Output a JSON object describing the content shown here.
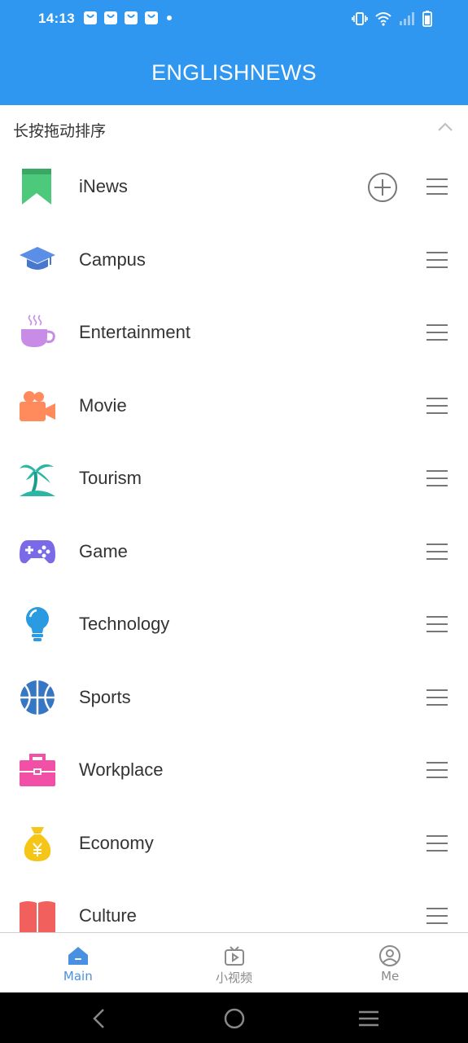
{
  "status_bar": {
    "time": "14:13",
    "notification_icons": [
      "shopping-bag-icon",
      "shopping-bag-icon",
      "shopping-bag-icon",
      "shopping-bag-icon",
      "dot-icon"
    ],
    "system_icons": [
      "vibrate-icon",
      "wifi-icon",
      "signal-icon",
      "battery-icon"
    ]
  },
  "header": {
    "title": "ENGLISHNEWS"
  },
  "sort_bar": {
    "hint": "长按拖动排序"
  },
  "channels": [
    {
      "label": "iNews",
      "icon": "bookmark-icon",
      "color": "#4cc97b",
      "has_add_button": true
    },
    {
      "label": "Campus",
      "icon": "graduation-cap-icon",
      "color": "#5b8ee6"
    },
    {
      "label": "Entertainment",
      "icon": "coffee-cup-icon",
      "color": "#c98ce6"
    },
    {
      "label": "Movie",
      "icon": "movie-camera-icon",
      "color": "#ff8a5b"
    },
    {
      "label": "Tourism",
      "icon": "palm-tree-icon",
      "color": "#2bb6a6"
    },
    {
      "label": "Game",
      "icon": "gamepad-icon",
      "color": "#7a6ae8"
    },
    {
      "label": "Technology",
      "icon": "lightbulb-icon",
      "color": "#2a9be0"
    },
    {
      "label": "Sports",
      "icon": "basketball-icon",
      "color": "#3576c5"
    },
    {
      "label": "Workplace",
      "icon": "briefcase-icon",
      "color": "#f24fa6"
    },
    {
      "label": "Economy",
      "icon": "money-bag-icon",
      "color": "#f5c518"
    },
    {
      "label": "Culture",
      "icon": "book-icon",
      "color": "#f2605e"
    }
  ],
  "bottom_nav": {
    "items": [
      {
        "label": "Main",
        "icon": "home-icon",
        "active": true
      },
      {
        "label": "小视频",
        "icon": "tv-video-icon",
        "active": false
      },
      {
        "label": "Me",
        "icon": "user-icon",
        "active": false
      }
    ],
    "active_color": "#4a90e2"
  },
  "colors": {
    "header_bg": "#2f97ef"
  }
}
